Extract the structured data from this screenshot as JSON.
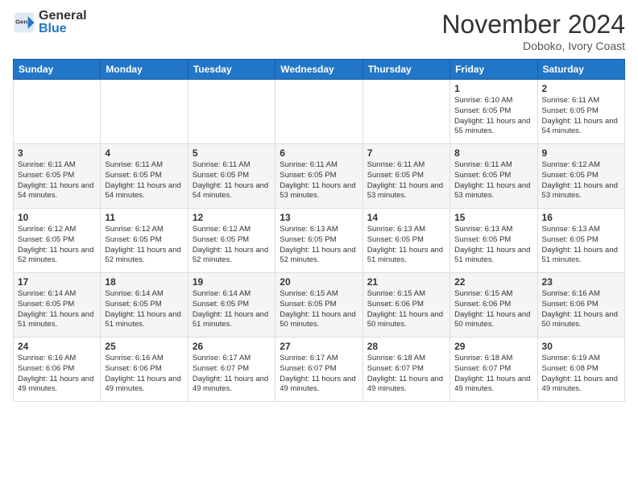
{
  "header": {
    "logo_general": "General",
    "logo_blue": "Blue",
    "month_title": "November 2024",
    "location": "Doboko, Ivory Coast"
  },
  "days_of_week": [
    "Sunday",
    "Monday",
    "Tuesday",
    "Wednesday",
    "Thursday",
    "Friday",
    "Saturday"
  ],
  "weeks": [
    [
      {
        "day": "",
        "info": ""
      },
      {
        "day": "",
        "info": ""
      },
      {
        "day": "",
        "info": ""
      },
      {
        "day": "",
        "info": ""
      },
      {
        "day": "",
        "info": ""
      },
      {
        "day": "1",
        "info": "Sunrise: 6:10 AM\nSunset: 6:05 PM\nDaylight: 11 hours\nand 55 minutes."
      },
      {
        "day": "2",
        "info": "Sunrise: 6:11 AM\nSunset: 6:05 PM\nDaylight: 11 hours\nand 54 minutes."
      }
    ],
    [
      {
        "day": "3",
        "info": "Sunrise: 6:11 AM\nSunset: 6:05 PM\nDaylight: 11 hours\nand 54 minutes."
      },
      {
        "day": "4",
        "info": "Sunrise: 6:11 AM\nSunset: 6:05 PM\nDaylight: 11 hours\nand 54 minutes."
      },
      {
        "day": "5",
        "info": "Sunrise: 6:11 AM\nSunset: 6:05 PM\nDaylight: 11 hours\nand 54 minutes."
      },
      {
        "day": "6",
        "info": "Sunrise: 6:11 AM\nSunset: 6:05 PM\nDaylight: 11 hours\nand 53 minutes."
      },
      {
        "day": "7",
        "info": "Sunrise: 6:11 AM\nSunset: 6:05 PM\nDaylight: 11 hours\nand 53 minutes."
      },
      {
        "day": "8",
        "info": "Sunrise: 6:11 AM\nSunset: 6:05 PM\nDaylight: 11 hours\nand 53 minutes."
      },
      {
        "day": "9",
        "info": "Sunrise: 6:12 AM\nSunset: 6:05 PM\nDaylight: 11 hours\nand 53 minutes."
      }
    ],
    [
      {
        "day": "10",
        "info": "Sunrise: 6:12 AM\nSunset: 6:05 PM\nDaylight: 11 hours\nand 52 minutes."
      },
      {
        "day": "11",
        "info": "Sunrise: 6:12 AM\nSunset: 6:05 PM\nDaylight: 11 hours\nand 52 minutes."
      },
      {
        "day": "12",
        "info": "Sunrise: 6:12 AM\nSunset: 6:05 PM\nDaylight: 11 hours\nand 52 minutes."
      },
      {
        "day": "13",
        "info": "Sunrise: 6:13 AM\nSunset: 6:05 PM\nDaylight: 11 hours\nand 52 minutes."
      },
      {
        "day": "14",
        "info": "Sunrise: 6:13 AM\nSunset: 6:05 PM\nDaylight: 11 hours\nand 51 minutes."
      },
      {
        "day": "15",
        "info": "Sunrise: 6:13 AM\nSunset: 6:05 PM\nDaylight: 11 hours\nand 51 minutes."
      },
      {
        "day": "16",
        "info": "Sunrise: 6:13 AM\nSunset: 6:05 PM\nDaylight: 11 hours\nand 51 minutes."
      }
    ],
    [
      {
        "day": "17",
        "info": "Sunrise: 6:14 AM\nSunset: 6:05 PM\nDaylight: 11 hours\nand 51 minutes."
      },
      {
        "day": "18",
        "info": "Sunrise: 6:14 AM\nSunset: 6:05 PM\nDaylight: 11 hours\nand 51 minutes."
      },
      {
        "day": "19",
        "info": "Sunrise: 6:14 AM\nSunset: 6:05 PM\nDaylight: 11 hours\nand 51 minutes."
      },
      {
        "day": "20",
        "info": "Sunrise: 6:15 AM\nSunset: 6:05 PM\nDaylight: 11 hours\nand 50 minutes."
      },
      {
        "day": "21",
        "info": "Sunrise: 6:15 AM\nSunset: 6:06 PM\nDaylight: 11 hours\nand 50 minutes."
      },
      {
        "day": "22",
        "info": "Sunrise: 6:15 AM\nSunset: 6:06 PM\nDaylight: 11 hours\nand 50 minutes."
      },
      {
        "day": "23",
        "info": "Sunrise: 6:16 AM\nSunset: 6:06 PM\nDaylight: 11 hours\nand 50 minutes."
      }
    ],
    [
      {
        "day": "24",
        "info": "Sunrise: 6:16 AM\nSunset: 6:06 PM\nDaylight: 11 hours\nand 49 minutes."
      },
      {
        "day": "25",
        "info": "Sunrise: 6:16 AM\nSunset: 6:06 PM\nDaylight: 11 hours\nand 49 minutes."
      },
      {
        "day": "26",
        "info": "Sunrise: 6:17 AM\nSunset: 6:07 PM\nDaylight: 11 hours\nand 49 minutes."
      },
      {
        "day": "27",
        "info": "Sunrise: 6:17 AM\nSunset: 6:07 PM\nDaylight: 11 hours\nand 49 minutes."
      },
      {
        "day": "28",
        "info": "Sunrise: 6:18 AM\nSunset: 6:07 PM\nDaylight: 11 hours\nand 49 minutes."
      },
      {
        "day": "29",
        "info": "Sunrise: 6:18 AM\nSunset: 6:07 PM\nDaylight: 11 hours\nand 49 minutes."
      },
      {
        "day": "30",
        "info": "Sunrise: 6:19 AM\nSunset: 6:08 PM\nDaylight: 11 hours\nand 49 minutes."
      }
    ]
  ]
}
